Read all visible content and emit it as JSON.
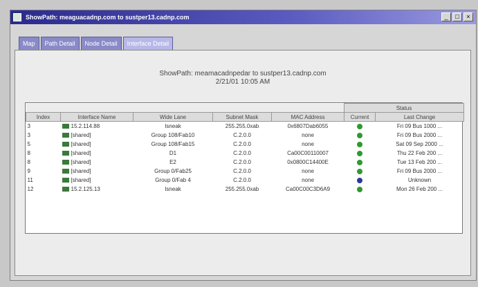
{
  "window": {
    "title": "ShowPath: meaguacadnp.com to sustper13.cadnp.com"
  },
  "titlebar_buttons": [
    "_",
    "□",
    "×"
  ],
  "tabs": [
    {
      "label": "Map",
      "active": false
    },
    {
      "label": "Path Detail",
      "active": false
    },
    {
      "label": "Node Detail",
      "active": false
    },
    {
      "label": "Interface Detail",
      "active": true
    }
  ],
  "header": {
    "line1": "ShowPath: meamacadnpedar to sustper13.cadnp.com",
    "line2": "2/21/01 10:05 AM"
  },
  "table": {
    "status_group": "Status",
    "columns": [
      "Index",
      "Interface Name",
      "Wide Lane",
      "Subnet Mask",
      "MAC Address",
      "Current",
      "Last Change"
    ],
    "rows": [
      {
        "index": "3",
        "name": "15.2.114.88",
        "wide": "Isneak",
        "mask": "255.255.0xab",
        "mac": "0x6807Dab6055",
        "status": "green",
        "last": "Fri 09 Bus 1000 ..."
      },
      {
        "index": "3",
        "name": "[shared]",
        "wide": "Group 108/Fab10",
        "mask": "C.2.0.0",
        "mac": "none",
        "status": "green",
        "last": "Fri 09 Bus 2000 ..."
      },
      {
        "index": "5",
        "name": "[shared]",
        "wide": "Group 108/Fab15",
        "mask": "C.2.0.0",
        "mac": "none",
        "status": "green",
        "last": "Sat 09 Sep 2000 ..."
      },
      {
        "index": "8",
        "name": "[shared]",
        "wide": "D1",
        "mask": "C.2.0.0",
        "mac": "Ca00C00110007",
        "status": "green",
        "last": "Thu 22 Feb 200 ..."
      },
      {
        "index": "8",
        "name": "[shared]",
        "wide": "E2",
        "mask": "C.2.0.0",
        "mac": "0x0800C14400E",
        "status": "green",
        "last": "Tue 13 Feb 200 ..."
      },
      {
        "index": "9",
        "name": "[shared]",
        "wide": "Group 0/Fab25",
        "mask": "C.2.0.0",
        "mac": "none",
        "status": "green",
        "last": "Fri 09 Bus 2000 ..."
      },
      {
        "index": "11",
        "name": "[shared]",
        "wide": "Group 0/Fab 4",
        "mask": "C.2.0.0",
        "mac": "none",
        "status": "blue",
        "last": "Unknown"
      },
      {
        "index": "12",
        "name": "15.2.125.13",
        "wide": "Isneak",
        "mask": "255.255.0xab",
        "mac": "Ca00C00C3D6A9",
        "status": "green",
        "last": "Mon 26 Feb 200 ..."
      }
    ]
  },
  "colors": {
    "status_green": "#2e9a2e",
    "status_blue": "#2a3a9a",
    "title_bar": "#2a2a8c"
  }
}
